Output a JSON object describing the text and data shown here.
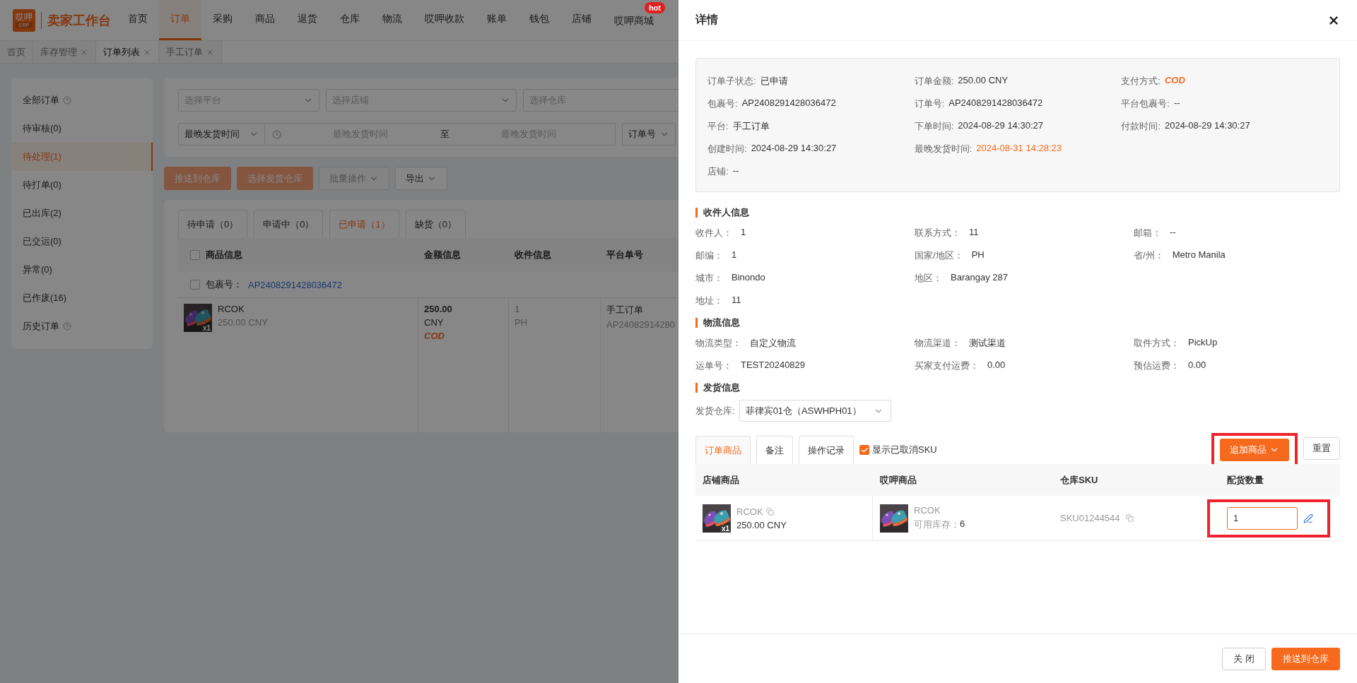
{
  "nav": {
    "logo_mark": "哎呷",
    "logo_sub": "ERP",
    "brand": "卖家工作台",
    "items": [
      {
        "label": "首页",
        "selected": false
      },
      {
        "label": "订单",
        "selected": true
      },
      {
        "label": "采购",
        "selected": false
      },
      {
        "label": "商品",
        "selected": false
      },
      {
        "label": "退货",
        "selected": false
      },
      {
        "label": "仓库",
        "selected": false
      },
      {
        "label": "物流",
        "selected": false
      },
      {
        "label": "哎呷收款",
        "selected": false
      },
      {
        "label": "账单",
        "selected": false
      },
      {
        "label": "钱包",
        "selected": false
      },
      {
        "label": "店铺",
        "selected": false
      },
      {
        "label": "哎呷商城",
        "selected": false,
        "badge": "hot"
      }
    ]
  },
  "page_tabs": [
    {
      "label": "首页",
      "closable": false,
      "selected": false
    },
    {
      "label": "库存管理",
      "closable": true,
      "selected": false
    },
    {
      "label": "订单列表",
      "closable": true,
      "selected": true
    },
    {
      "label": "手工订单",
      "closable": true,
      "selected": false
    }
  ],
  "sidebar": {
    "items": [
      {
        "label": "全部订单",
        "help": true,
        "selected": false
      },
      {
        "label": "待审核(0)",
        "help": false,
        "selected": false
      },
      {
        "label": "待处理(1)",
        "help": false,
        "selected": true
      },
      {
        "label": "待打单(0)",
        "help": false,
        "selected": false
      },
      {
        "label": "已出库(2)",
        "help": false,
        "selected": false
      },
      {
        "label": "已交运(0)",
        "help": false,
        "selected": false
      },
      {
        "label": "异常(0)",
        "help": false,
        "selected": false
      },
      {
        "label": "已作废(16)",
        "help": false,
        "selected": false
      },
      {
        "label": "历史订单",
        "help": true,
        "selected": false
      }
    ]
  },
  "filters": {
    "selects": [
      {
        "placeholder": "选择平台"
      },
      {
        "placeholder": "选择店铺"
      },
      {
        "placeholder": "选择仓库"
      }
    ],
    "date_filter": {
      "type": "最晚发货时间",
      "start_placeholder": "最晚发货时间",
      "separator": "至",
      "end_placeholder": "最晚发货时间"
    },
    "order_field": "订单号"
  },
  "actions": [
    {
      "label": "推送到仓库",
      "kind": "primary"
    },
    {
      "label": "选择发货仓库",
      "kind": "primary"
    },
    {
      "label": "批量操作",
      "kind": "menu_disabled"
    },
    {
      "label": "导出",
      "kind": "menu"
    }
  ],
  "status_tabs": [
    {
      "label": "待申请（0）",
      "selected": false
    },
    {
      "label": "申请中（0）",
      "selected": false
    },
    {
      "label": "已申请（1）",
      "selected": true
    },
    {
      "label": "缺货（0）",
      "selected": false
    }
  ],
  "orders_table": {
    "columns": [
      "商品信息",
      "金额信息",
      "收件信息",
      "平台单号"
    ],
    "all_checked": false,
    "package_checked": false,
    "package_label": "包裹号：",
    "package_no": "AP2408291428036472",
    "row": {
      "product": "RCOK",
      "price": "250.00 CNY",
      "qty": "x1",
      "amount": "250.00",
      "currency": "CNY",
      "payment": "COD",
      "recipient": "1",
      "country": "PH",
      "platform": "手工订单",
      "platform_no": "AP24082914280"
    }
  },
  "drawer": {
    "title": "详情",
    "summary": [
      [
        {
          "label": "订单子状态:",
          "value": "已申请",
          "kind": "text"
        },
        {
          "label": "订单金额:",
          "value": "250.00 CNY",
          "kind": "text"
        },
        {
          "label": "支付方式:",
          "value": "COD",
          "kind": "cod"
        }
      ],
      [
        {
          "label": "包裹号:",
          "value": "AP2408291428036472",
          "kind": "text"
        },
        {
          "label": "订单号:",
          "value": "AP2408291428036472",
          "kind": "text"
        },
        {
          "label": "平台包裹号:",
          "value": "--",
          "kind": "text"
        }
      ],
      [
        {
          "label": "平台:",
          "value": "手工订单",
          "kind": "text"
        },
        {
          "label": "下单时间:",
          "value": "2024-08-29 14:30:27",
          "kind": "text"
        },
        {
          "label": "付款时间:",
          "value": "2024-08-29 14:30:27",
          "kind": "text"
        }
      ],
      [
        {
          "label": "创建时间:",
          "value": "2024-08-29 14:30:27",
          "kind": "text"
        },
        {
          "label": "最晚发货时间:",
          "value": "2024-08-31 14:28:23",
          "kind": "alert"
        }
      ],
      [
        {
          "label": "店铺:",
          "value": "--",
          "kind": "text"
        }
      ]
    ],
    "sections": [
      {
        "title": "收件人信息",
        "rows": [
          [
            {
              "label": "收件人：",
              "value": "1"
            },
            {
              "label": "联系方式：",
              "value": "11"
            },
            {
              "label": "邮箱：",
              "value": "--"
            }
          ],
          [
            {
              "label": "邮编：",
              "value": "1"
            },
            {
              "label": "国家/地区：",
              "value": "PH"
            },
            {
              "label": "省/州：",
              "value": "Metro Manila"
            }
          ],
          [
            {
              "label": "城市：",
              "value": "Binondo"
            },
            {
              "label": "地区：",
              "value": "Barangay 287"
            }
          ],
          [
            {
              "label": "地址：",
              "value": "11"
            }
          ]
        ]
      },
      {
        "title": "物流信息",
        "rows": [
          [
            {
              "label": "物流类型：",
              "value": "自定义物流"
            },
            {
              "label": "物流渠道：",
              "value": "测试渠道"
            },
            {
              "label": "取件方式：",
              "value": "PickUp"
            }
          ],
          [
            {
              "label": "运单号：",
              "value": "TEST20240829"
            },
            {
              "label": "买家支付运费：",
              "value": "0.00"
            },
            {
              "label": "预估运费：",
              "value": "0.00"
            }
          ]
        ]
      }
    ],
    "shipping": {
      "title": "发货信息",
      "warehouse_label": "发货仓库:",
      "warehouse": "菲律宾01仓（ASWHPH01）"
    },
    "item_tabs": [
      {
        "label": "订单商品",
        "selected": true
      },
      {
        "label": "备注",
        "selected": false
      },
      {
        "label": "操作记录",
        "selected": false
      }
    ],
    "show_cancelled": {
      "label": "显示已取消SKU",
      "checked": true
    },
    "add_button": {
      "label": "追加商品",
      "highlighted": true
    },
    "reset_button": "重置",
    "items_table": {
      "columns": [
        "店铺商品",
        "哎呷商品",
        "仓库SKU",
        "配货数量"
      ],
      "rows": [
        {
          "store_name": "RCOK",
          "store_price": "250.00 CNY",
          "qty": "x1",
          "ahya_name": "RCOK",
          "stock_label": "可用库存：",
          "stock": "6",
          "sku": "SKU01244544",
          "quantity": "1",
          "highlighted": true
        }
      ]
    },
    "footer_buttons": [
      {
        "label": "关 闭",
        "kind": "default"
      },
      {
        "label": "推送到仓库",
        "kind": "primary"
      }
    ]
  }
}
